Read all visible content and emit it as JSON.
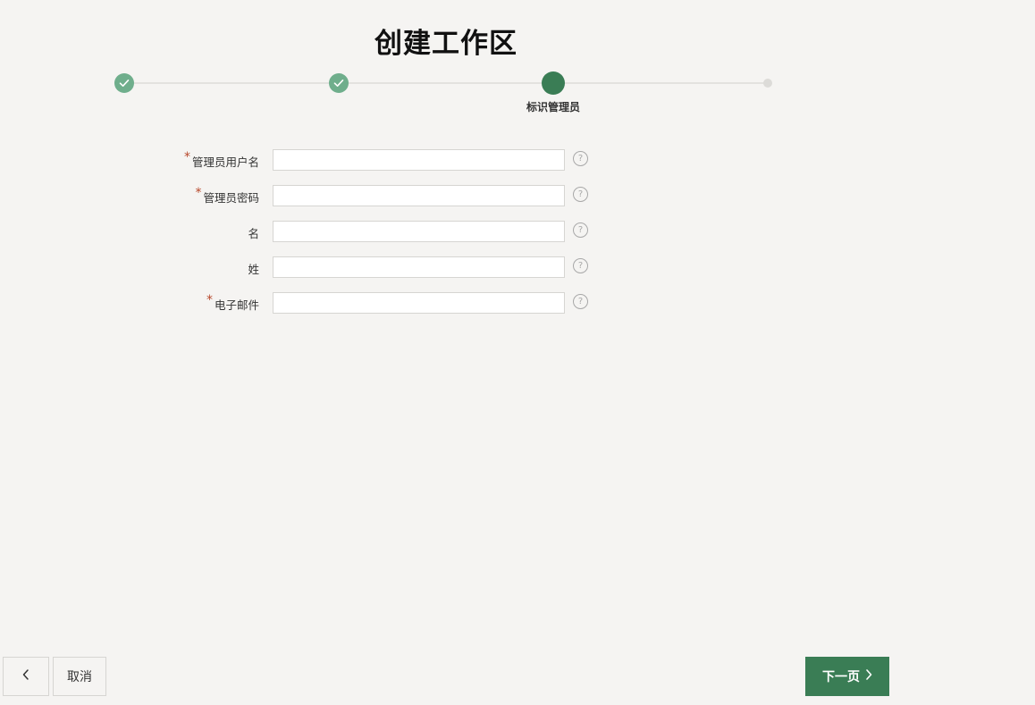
{
  "page": {
    "title": "创建工作区"
  },
  "wizard": {
    "steps": [
      {
        "state": "completed",
        "label": ""
      },
      {
        "state": "completed",
        "label": ""
      },
      {
        "state": "current",
        "label": "标识管理员"
      },
      {
        "state": "future",
        "label": ""
      }
    ]
  },
  "form": {
    "fields": [
      {
        "label": "管理员用户名",
        "required": true,
        "value": "",
        "help_icon": "question-circle-icon"
      },
      {
        "label": "管理员密码",
        "required": true,
        "value": "",
        "help_icon": "question-circle-icon"
      },
      {
        "label": "名",
        "required": false,
        "value": "",
        "help_icon": "question-circle-icon"
      },
      {
        "label": "姓",
        "required": false,
        "value": "",
        "help_icon": "question-circle-icon"
      },
      {
        "label": "电子邮件",
        "required": true,
        "value": "",
        "help_icon": "question-circle-icon"
      }
    ],
    "required_marker": "*",
    "help_glyph": "?"
  },
  "footer": {
    "back_icon": "chevron-left-icon",
    "cancel_label": "取消",
    "next_label": "下一页",
    "next_icon": "chevron-right-icon"
  },
  "colors": {
    "background": "#f5f4f2",
    "accent": "#3a7d55",
    "completed_step": "#6fae8c",
    "required_marker": "#b7472a"
  }
}
